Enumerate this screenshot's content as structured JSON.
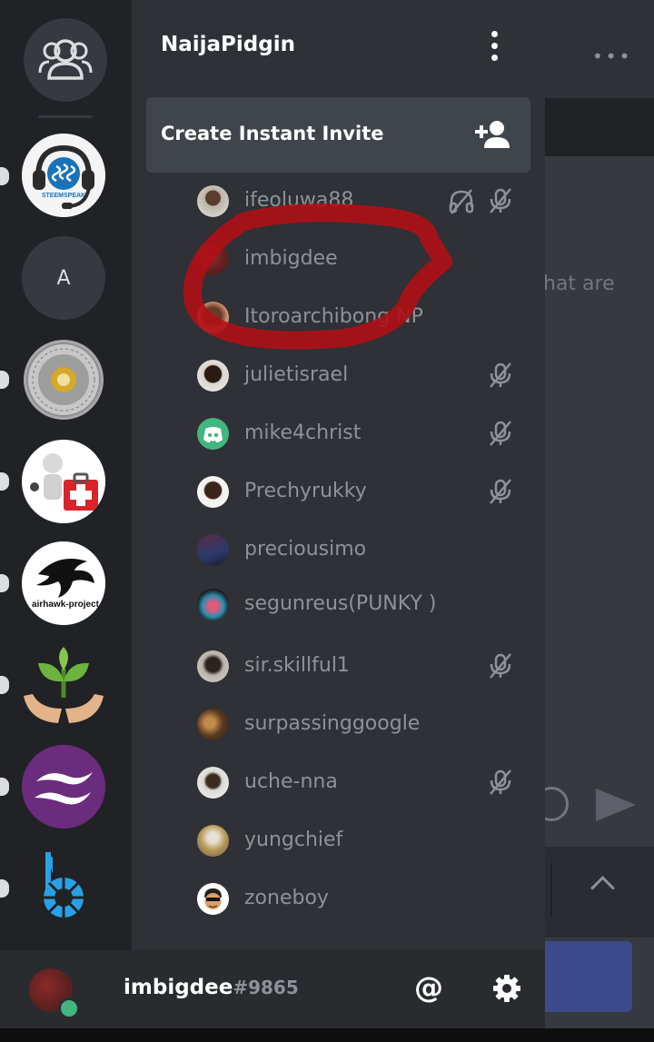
{
  "server_name": "NaijaPidgin",
  "invite_label": "Create Instant Invite",
  "rail": {
    "servers": [
      {
        "name": "steemspeak",
        "label": "STEEMSPEAK"
      },
      {
        "name": "A-server",
        "label": "A"
      },
      {
        "name": "coin-server"
      },
      {
        "name": "medical-server"
      },
      {
        "name": "airhawk-project",
        "label": "airhawk-project"
      },
      {
        "name": "plant-hands-server"
      },
      {
        "name": "purple-wave-server"
      },
      {
        "name": "bittube-server"
      }
    ]
  },
  "members": [
    {
      "name": "ifeoluwa88",
      "icons": [
        "deafened-icon",
        "muted-mic-icon"
      ]
    },
    {
      "name": "imbigdee",
      "icons": []
    },
    {
      "name": "Itoroarchibong NP",
      "icons": []
    },
    {
      "name": "julietisrael",
      "icons": [
        "muted-mic-icon"
      ]
    },
    {
      "name": "mike4christ",
      "icons": [
        "muted-mic-icon"
      ]
    },
    {
      "name": "Prechyrukky",
      "icons": [
        "muted-mic-icon"
      ]
    },
    {
      "name": "preciousimo",
      "icons": []
    },
    {
      "name": "segunreus(PUNKY )",
      "icons": []
    },
    {
      "name": "sir.skillful1",
      "icons": [
        "muted-mic-icon"
      ]
    },
    {
      "name": "surpassinggoogle",
      "icons": []
    },
    {
      "name": "uche-nna",
      "icons": [
        "muted-mic-icon"
      ]
    },
    {
      "name": "yungchief",
      "icons": []
    },
    {
      "name": "zoneboy",
      "icons": []
    }
  ],
  "user": {
    "name": "imbigdee",
    "tag": "#9865",
    "status": "online"
  },
  "chat_partial_text": "hat are",
  "colors": {
    "accent": "#7289da",
    "online": "#43b581",
    "annotation": "#b10f16"
  }
}
